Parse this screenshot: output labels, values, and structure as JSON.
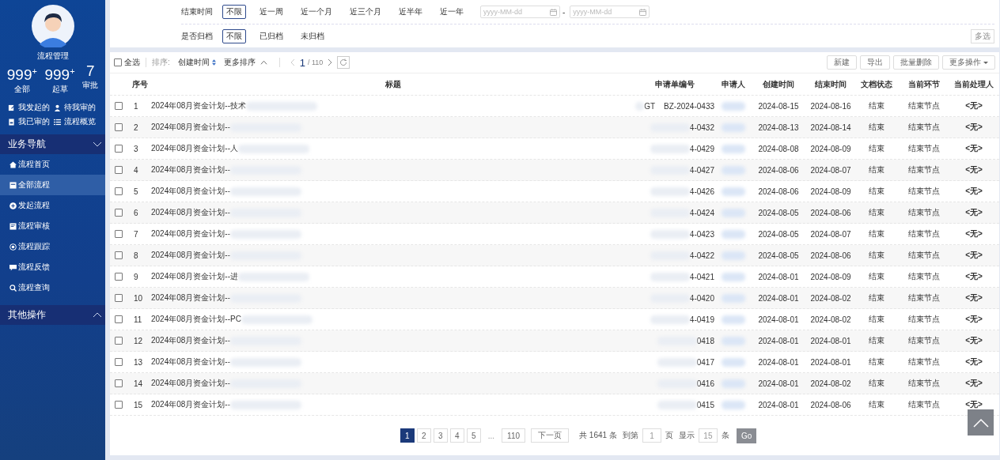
{
  "sidebar": {
    "title": "流程管理",
    "counts": [
      {
        "value": "999$^{+}$",
        "label": "全部"
      },
      {
        "value": "999$^{+}$",
        "label": "起草"
      },
      {
        "value": "7",
        "label": "审批"
      }
    ],
    "links": [
      {
        "label": "我发起的",
        "kind": "edit"
      },
      {
        "label": "待我审的",
        "kind": "user"
      },
      {
        "label": "我已审的",
        "kind": "doc"
      },
      {
        "label": "流程概览",
        "kind": "list"
      }
    ],
    "sections": [
      {
        "label": "业务导航",
        "expanded": true,
        "items": [
          {
            "label": "流程首页",
            "kind": "home",
            "selected": false
          },
          {
            "label": "全部流程",
            "kind": "box",
            "selected": true
          },
          {
            "label": "发起流程",
            "kind": "plus",
            "selected": false
          },
          {
            "label": "流程审核",
            "kind": "doc",
            "selected": false
          },
          {
            "label": "流程跟踪",
            "kind": "target",
            "selected": false
          },
          {
            "label": "流程反馈",
            "kind": "chat",
            "selected": false
          },
          {
            "label": "流程查询",
            "kind": "search",
            "selected": false
          }
        ]
      },
      {
        "label": "其他操作",
        "expanded": false
      }
    ]
  },
  "filters": [
    {
      "label": "结束时间",
      "options": [
        {
          "label": "不限",
          "selected": true
        },
        {
          "label": "近一周",
          "selected": false
        },
        {
          "label": "近一个月",
          "selected": false
        },
        {
          "label": "近三个月",
          "selected": false
        },
        {
          "label": "近半年",
          "selected": false
        },
        {
          "label": "近一年",
          "selected": false
        }
      ],
      "date_range": {
        "start_placeholder": "yyyy-MM-dd",
        "separator": "-",
        "end_placeholder": "yyyy-MM-dd"
      }
    },
    {
      "label": "是否归档",
      "options": [
        {
          "label": "不限",
          "selected": true
        },
        {
          "label": "已归档",
          "selected": false
        },
        {
          "label": "未归档",
          "selected": false
        }
      ],
      "multi_button": "多选"
    }
  ],
  "toolbar": {
    "select_all": {
      "label": "全选",
      "checked": false
    },
    "sort_label": "排序:",
    "sort_field": "创建时间",
    "more_sort": "更多排序",
    "page": "1",
    "page_total": "/ 110",
    "buttons": [
      "新建",
      "导出",
      "批量删除",
      "更多操作"
    ]
  },
  "table": {
    "columns": [
      "序号",
      "标题",
      "申请单编号",
      "申请人",
      "创建时间",
      "结束时间",
      "文档状态",
      "当前环节",
      "当前处理人"
    ],
    "rows": [
      {
        "checked": false,
        "no": "1",
        "title": "2024年08月资金计划--技术",
        "code": "GT    BZ-2024-0433",
        "created": "2024-08-15",
        "ended": "2024-08-16",
        "status": "结束",
        "stage": "结束节点",
        "handler": "<无>"
      },
      {
        "checked": false,
        "no": "2",
        "title": "2024年08月资金计划--",
        "code": "4-0432",
        "created": "2024-08-13",
        "ended": "2024-08-14",
        "status": "结束",
        "stage": "结束节点",
        "handler": "<无>"
      },
      {
        "checked": false,
        "no": "3",
        "title": "2024年08月资金计划--人",
        "code": "4-0429",
        "created": "2024-08-08",
        "ended": "2024-08-09",
        "status": "结束",
        "stage": "结束节点",
        "handler": "<无>"
      },
      {
        "checked": false,
        "no": "4",
        "title": "2024年08月资金计划--",
        "code": "4-0427",
        "created": "2024-08-06",
        "ended": "2024-08-07",
        "status": "结束",
        "stage": "结束节点",
        "handler": "<无>"
      },
      {
        "checked": false,
        "no": "5",
        "title": "2024年08月资金计划--",
        "code": "4-0426",
        "created": "2024-08-06",
        "ended": "2024-08-09",
        "status": "结束",
        "stage": "结束节点",
        "handler": "<无>"
      },
      {
        "checked": false,
        "no": "6",
        "title": "2024年08月资金计划--",
        "code": "4-0424",
        "created": "2024-08-05",
        "ended": "2024-08-06",
        "status": "结束",
        "stage": "结束节点",
        "handler": "<无>"
      },
      {
        "checked": false,
        "no": "7",
        "title": "2024年08月资金计划--",
        "code": "4-0423",
        "created": "2024-08-05",
        "ended": "2024-08-07",
        "status": "结束",
        "stage": "结束节点",
        "handler": "<无>"
      },
      {
        "checked": false,
        "no": "8",
        "title": "2024年08月资金计划--",
        "code": "4-0422",
        "created": "2024-08-05",
        "ended": "2024-08-06",
        "status": "结束",
        "stage": "结束节点",
        "handler": "<无>"
      },
      {
        "checked": false,
        "no": "9",
        "title": "2024年08月资金计划--进",
        "code": "4-0421",
        "created": "2024-08-01",
        "ended": "2024-08-09",
        "status": "结束",
        "stage": "结束节点",
        "handler": "<无>"
      },
      {
        "checked": false,
        "no": "10",
        "title": "2024年08月资金计划--",
        "code": "4-0420",
        "created": "2024-08-01",
        "ended": "2024-08-02",
        "status": "结束",
        "stage": "结束节点",
        "handler": "<无>"
      },
      {
        "checked": false,
        "no": "11",
        "title": "2024年08月资金计划--PC",
        "code": "4-0419",
        "created": "2024-08-01",
        "ended": "2024-08-02",
        "status": "结束",
        "stage": "结束节点",
        "handler": "<无>"
      },
      {
        "checked": false,
        "no": "12",
        "title": "2024年08月资金计划--",
        "code": "0418",
        "created": "2024-08-01",
        "ended": "2024-08-01",
        "status": "结束",
        "stage": "结束节点",
        "handler": "<无>"
      },
      {
        "checked": false,
        "no": "13",
        "title": "2024年08月资金计划--",
        "code": "0417",
        "created": "2024-08-01",
        "ended": "2024-08-01",
        "status": "结束",
        "stage": "结束节点",
        "handler": "<无>"
      },
      {
        "checked": false,
        "no": "14",
        "title": "2024年08月资金计划--",
        "code": "0416",
        "created": "2024-08-01",
        "ended": "2024-08-02",
        "status": "结束",
        "stage": "结束节点",
        "handler": "<无>"
      },
      {
        "checked": false,
        "no": "15",
        "title": "2024年08月资金计划--",
        "code": "0415",
        "created": "2024-08-01",
        "ended": "2024-08-06",
        "status": "结束",
        "stage": "结束节点",
        "handler": "<无>"
      }
    ]
  },
  "pagination": {
    "pages": [
      {
        "label": "1",
        "selected": true
      },
      {
        "label": "2",
        "selected": false
      },
      {
        "label": "3",
        "selected": false
      },
      {
        "label": "4",
        "selected": false
      },
      {
        "label": "5",
        "selected": false
      }
    ],
    "ellipsis": "...",
    "last": "110",
    "next": "下一页",
    "total": "共 1641 条",
    "goto_label": "到第",
    "goto_value": "1",
    "page_unit": "页",
    "size_label": "显示",
    "size_value": "15",
    "size_unit": "条",
    "go": "Go"
  }
}
